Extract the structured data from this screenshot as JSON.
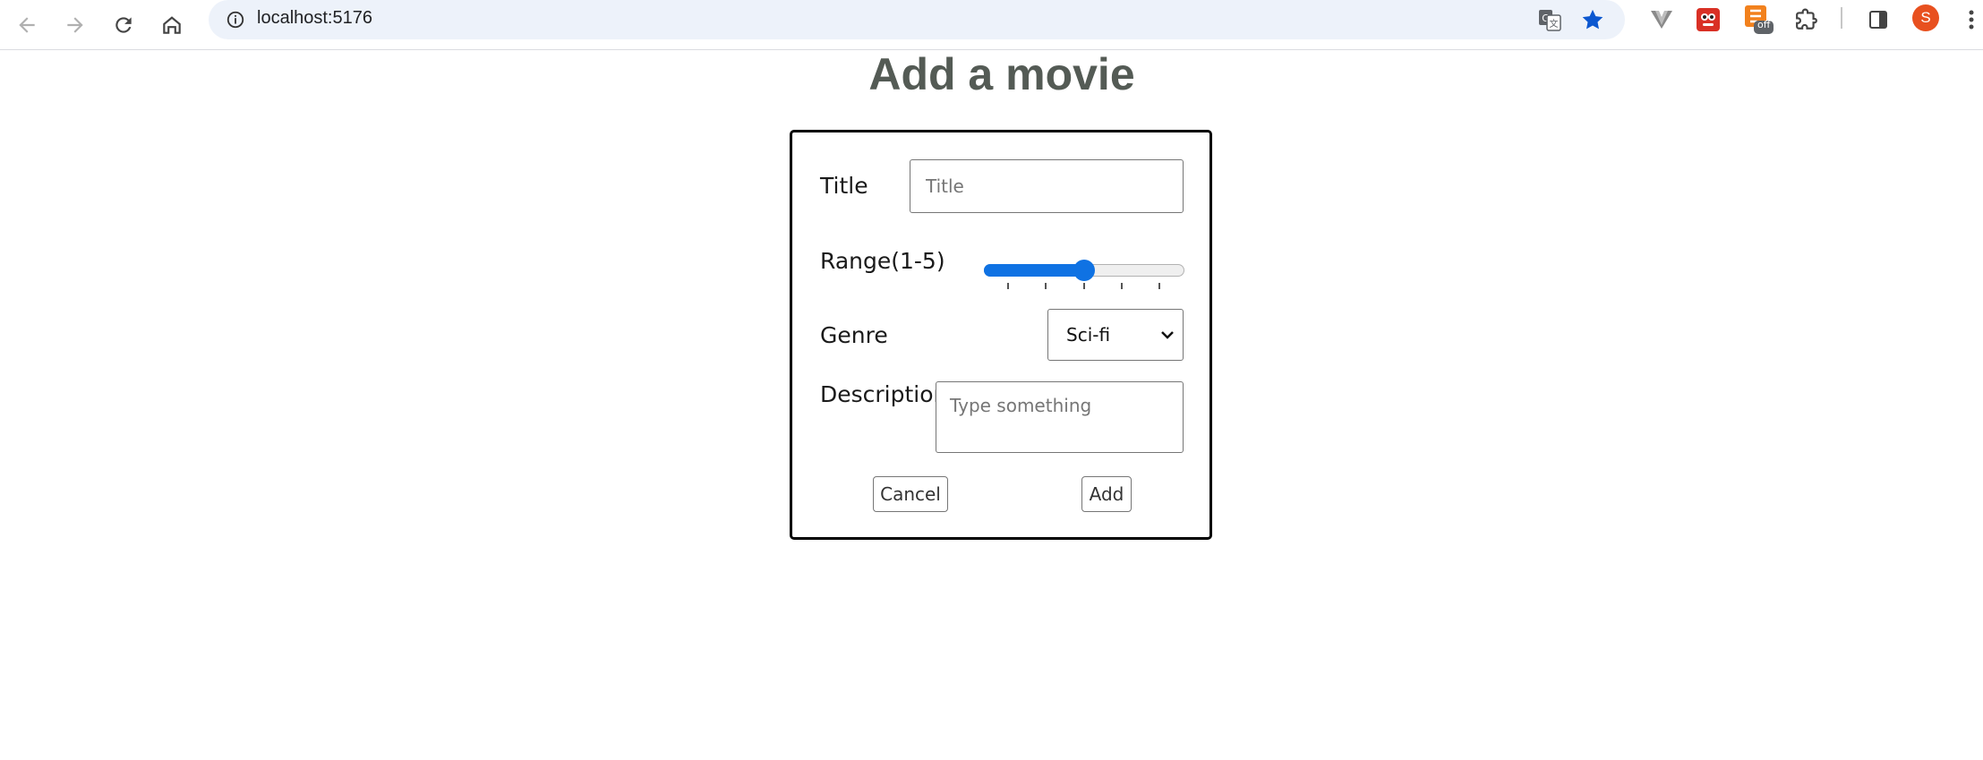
{
  "browser": {
    "url": "localhost:5176",
    "avatar_initial": "S",
    "extension_badge": "off",
    "icons": [
      "back-icon",
      "forward-icon",
      "reload-icon",
      "home-icon",
      "site-info-icon",
      "translate-icon",
      "bookmark-star-icon",
      "extension-icon",
      "puzzle-icon",
      "side-panel-icon",
      "menu-icon"
    ],
    "colors": {
      "star": "#0b57d0",
      "avatar": "#e8501f",
      "omnibox": "#edf2fa"
    }
  },
  "page": {
    "title": "Add a movie"
  },
  "form": {
    "title_label": "Title",
    "title_placeholder": "Title",
    "title_value": "",
    "range_label": "Range(1-5)",
    "range": {
      "min": 1,
      "max": 5,
      "value": 3,
      "ticks": [
        1,
        2,
        3,
        4,
        5
      ]
    },
    "genre_label": "Genre",
    "genre_selected": "Sci-fi",
    "description_label": "Description",
    "description_placeholder": "Type something",
    "description_value": "",
    "cancel_label": "Cancel",
    "add_label": "Add",
    "colors": {
      "accent": "#0f72e3",
      "title_text": "#545b55",
      "border": "#000000"
    }
  }
}
